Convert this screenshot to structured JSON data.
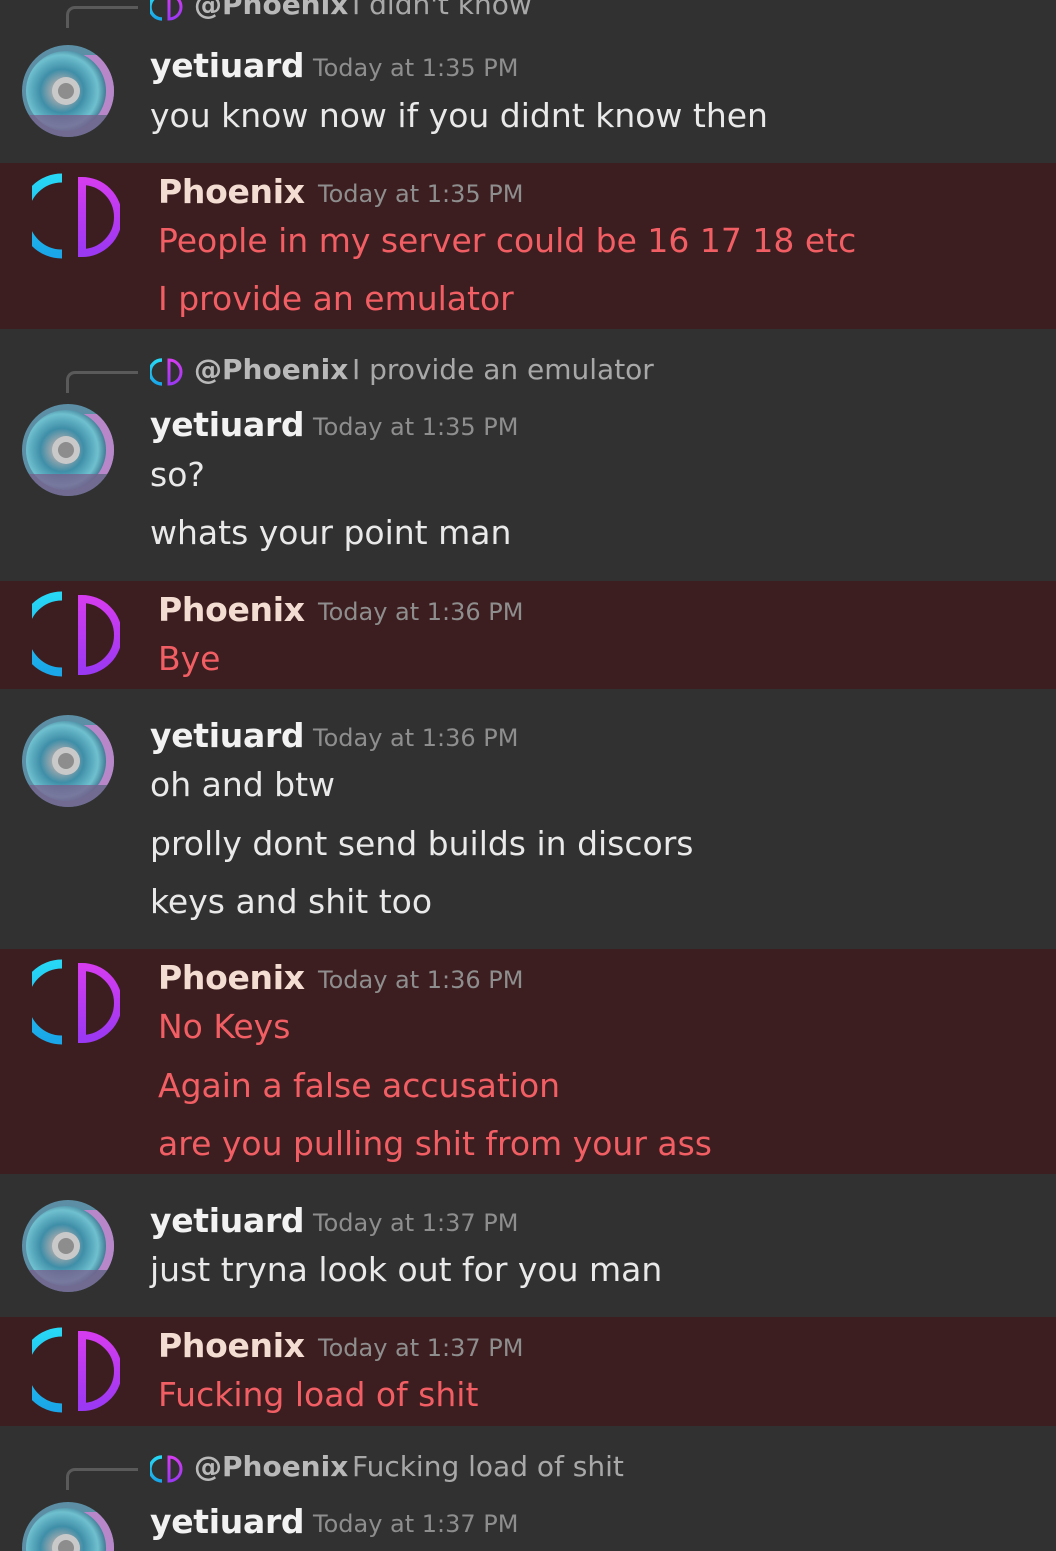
{
  "colors": {
    "phoenix_row_bg": "#3d1e20",
    "default_bg": "#313131",
    "phoenix_message_text": "#f15e63",
    "yeti_message_text": "#e9e9e9",
    "timestamp": "#8e8e8e"
  },
  "icons": {
    "phoenix_avatar": "yuzu-logo-icon",
    "yeti_avatar": "disc-avatar-icon"
  },
  "groups": [
    {
      "reply": {
        "mention": "@Phoenix",
        "text": "I didn't know"
      },
      "username": "yetiuard",
      "timestamp": "Today at 1:35 PM",
      "messages": [
        "you know now if you didnt know then"
      ]
    },
    {
      "username": "Phoenix",
      "timestamp": "Today at 1:35 PM",
      "messages": [
        "People in my server could be 16 17 18 etc",
        "I provide an emulator"
      ]
    },
    {
      "reply": {
        "mention": "@Phoenix",
        "text": "I provide an emulator"
      },
      "username": "yetiuard",
      "timestamp": "Today at 1:35 PM",
      "messages": [
        "so?",
        "whats your point man"
      ]
    },
    {
      "username": "Phoenix",
      "timestamp": "Today at 1:36 PM",
      "messages": [
        "Bye"
      ]
    },
    {
      "username": "yetiuard",
      "timestamp": "Today at 1:36 PM",
      "messages": [
        "oh and btw",
        "prolly dont send builds in discors",
        "keys and shit too"
      ]
    },
    {
      "username": "Phoenix",
      "timestamp": "Today at 1:36 PM",
      "messages": [
        "No Keys",
        "Again a false accusation",
        "are you pulling shit from your ass"
      ]
    },
    {
      "username": "yetiuard",
      "timestamp": "Today at 1:37 PM",
      "messages": [
        "just tryna look out for you man"
      ]
    },
    {
      "username": "Phoenix",
      "timestamp": "Today at 1:37 PM",
      "messages": [
        "Fucking load of shit"
      ]
    },
    {
      "reply": {
        "mention": "@Phoenix",
        "text": "Fucking load of shit"
      },
      "username": "yetiuard",
      "timestamp": "Today at 1:37 PM",
      "messages": []
    }
  ]
}
